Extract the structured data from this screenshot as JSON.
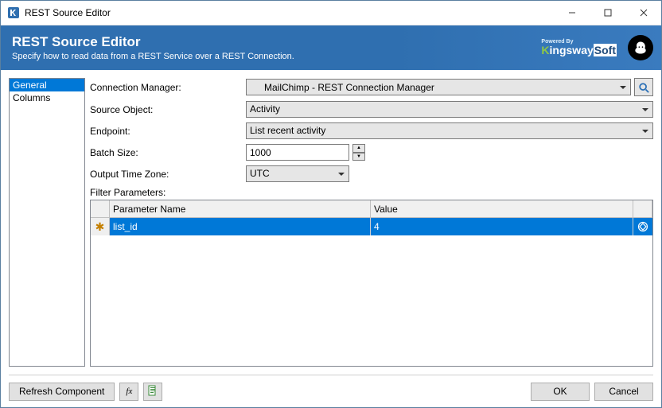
{
  "window": {
    "title": "REST Source Editor"
  },
  "banner": {
    "heading": "REST Source Editor",
    "subtitle": "Specify how to read data from a REST Service over a REST Connection.",
    "powered_by_label": "Powered By",
    "brand_name_k": "K",
    "brand_name_rest": "ingsway",
    "brand_name_soft": "Soft"
  },
  "nav": {
    "items": [
      {
        "label": "General",
        "selected": true
      },
      {
        "label": "Columns",
        "selected": false
      }
    ]
  },
  "form": {
    "connection_manager": {
      "label": "Connection Manager:",
      "value": "MailChimp - REST Connection Manager"
    },
    "source_object": {
      "label": "Source Object:",
      "value": "Activity"
    },
    "endpoint": {
      "label": "Endpoint:",
      "value": "List recent activity"
    },
    "batch_size": {
      "label": "Batch Size:",
      "value": "1000"
    },
    "output_time_zone": {
      "label": "Output Time Zone:",
      "value": "UTC"
    },
    "filter_parameters_label": "Filter Parameters:"
  },
  "table": {
    "headers": {
      "name": "Parameter Name",
      "value": "Value"
    },
    "rows": [
      {
        "name": "list_id",
        "value": "4",
        "required": true,
        "selected": true
      }
    ]
  },
  "footer": {
    "refresh_label": "Refresh Component",
    "ok_label": "OK",
    "cancel_label": "Cancel"
  }
}
